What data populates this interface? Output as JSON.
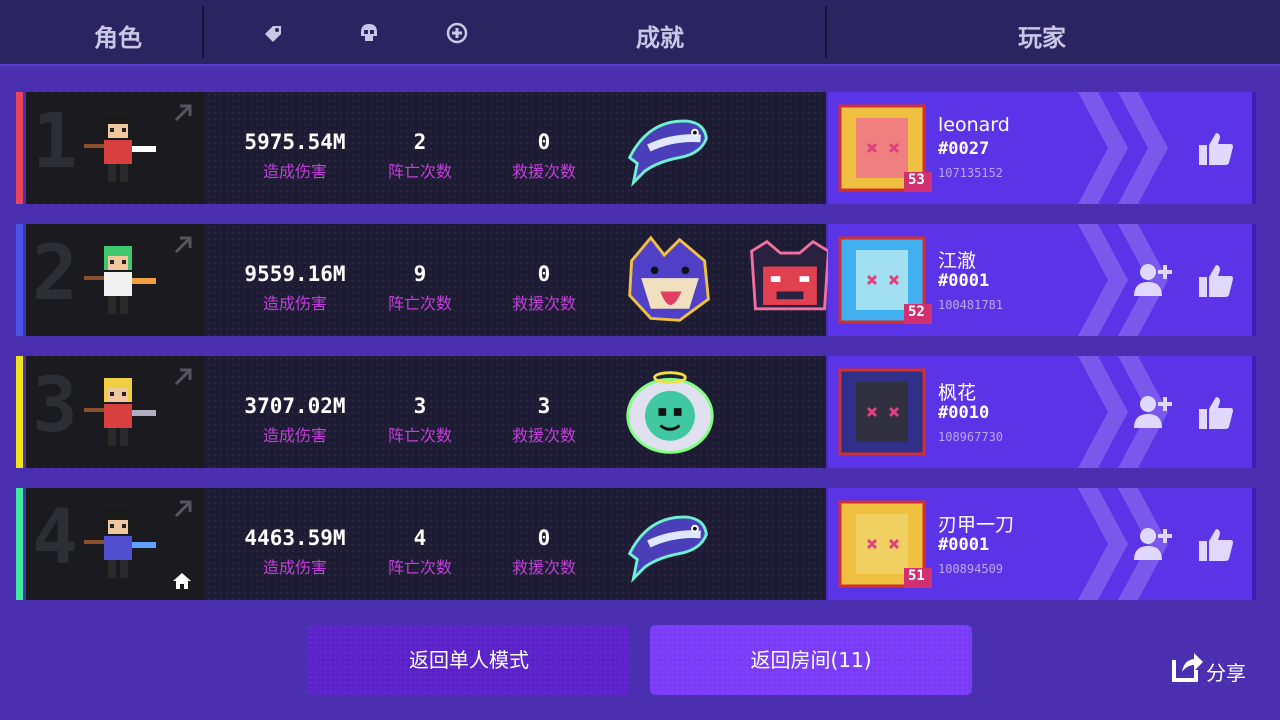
{
  "header": {
    "col_character": "角色",
    "col_achievement": "成就",
    "col_player": "玩家",
    "icons": [
      "tag-icon",
      "skull-icon",
      "plus-circle-icon"
    ]
  },
  "stat_labels": {
    "damage": "造成伤害",
    "deaths": "阵亡次数",
    "rescues": "救援次数"
  },
  "rows": [
    {
      "rank": "1",
      "accent": "#e8445a",
      "damage": "5975.54M",
      "deaths": "2",
      "rescues": "0",
      "achievements": [
        "fish-achievement"
      ],
      "player": {
        "name": "leonard",
        "tag": "#0027",
        "id": "107135152",
        "level": "53"
      },
      "is_self": false,
      "show_add_friend": false
    },
    {
      "rank": "2",
      "accent": "#4a56e8",
      "damage": "9559.16M",
      "deaths": "9",
      "rescues": "0",
      "achievements": [
        "wolf-achievement",
        "demon-achievement"
      ],
      "player": {
        "name": "江澈",
        "tag": "#0001",
        "id": "100481781",
        "level": "52"
      },
      "is_self": false,
      "show_add_friend": true
    },
    {
      "rank": "3",
      "accent": "#f0e020",
      "damage": "3707.02M",
      "deaths": "3",
      "rescues": "3",
      "achievements": [
        "angel-achievement"
      ],
      "player": {
        "name": "枫花",
        "tag": "#0010",
        "id": "108967730",
        "level": ""
      },
      "is_self": false,
      "show_add_friend": true
    },
    {
      "rank": "4",
      "accent": "#40e8a0",
      "damage": "4463.59M",
      "deaths": "4",
      "rescues": "0",
      "achievements": [
        "fish-achievement"
      ],
      "player": {
        "name": "刃甲一刀",
        "tag": "#0001",
        "id": "100894509",
        "level": "51"
      },
      "is_self": true,
      "show_add_friend": true
    }
  ],
  "buttons": {
    "return_single": "返回单人模式",
    "return_room": "返回房间(11)",
    "share": "分享"
  }
}
